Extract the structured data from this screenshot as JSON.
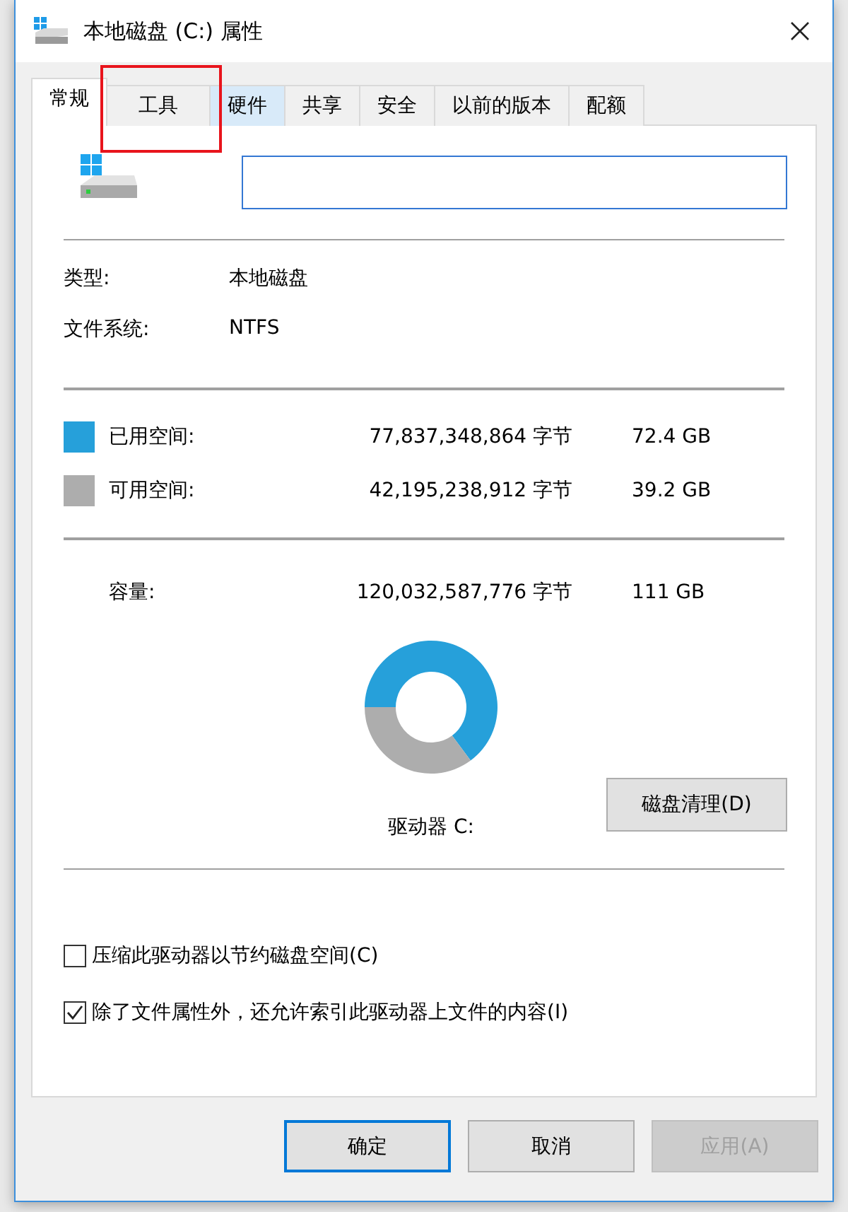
{
  "window": {
    "title": "本地磁盘 (C:) 属性"
  },
  "tabs": [
    {
      "label": "常规",
      "selected": true,
      "hovered": false,
      "highlighted": false
    },
    {
      "label": "工具",
      "selected": false,
      "hovered": false,
      "highlighted": true
    },
    {
      "label": "硬件",
      "selected": false,
      "hovered": true,
      "highlighted": false
    },
    {
      "label": "共享",
      "selected": false,
      "hovered": false,
      "highlighted": false
    },
    {
      "label": "安全",
      "selected": false,
      "hovered": false,
      "highlighted": false
    },
    {
      "label": "以前的版本",
      "selected": false,
      "hovered": false,
      "highlighted": false
    },
    {
      "label": "配额",
      "selected": false,
      "hovered": false,
      "highlighted": false
    }
  ],
  "info": [
    {
      "label": "类型:",
      "value": "本地磁盘"
    },
    {
      "label": "文件系统:",
      "value": "NTFS"
    }
  ],
  "space": [
    {
      "label": "已用空间:",
      "bytes": "77,837,348,864 字节",
      "size": "72.4 GB",
      "color": "#26a0da"
    },
    {
      "label": "可用空间:",
      "bytes": "42,195,238,912 字节",
      "size": "39.2 GB",
      "color": "#adadad"
    }
  ],
  "capacity": {
    "label": "容量:",
    "bytes": "120,032,587,776 字节",
    "size": "111 GB"
  },
  "chart_data": {
    "type": "donut",
    "values": [
      64.85,
      35.15
    ]
  },
  "drive_label": "驱动器 C:",
  "cleanup_button": "磁盘清理(D)",
  "options": [
    {
      "label": "压缩此驱动器以节约磁盘空间(C)",
      "checked": false
    },
    {
      "label": "除了文件属性外，还允许索引此驱动器上文件的内容(I)",
      "checked": true
    }
  ],
  "buttons": [
    {
      "label": "确定",
      "default": true,
      "disabled": false
    },
    {
      "label": "取消",
      "default": false,
      "disabled": false
    },
    {
      "label": "应用(A)",
      "default": false,
      "disabled": true
    }
  ]
}
